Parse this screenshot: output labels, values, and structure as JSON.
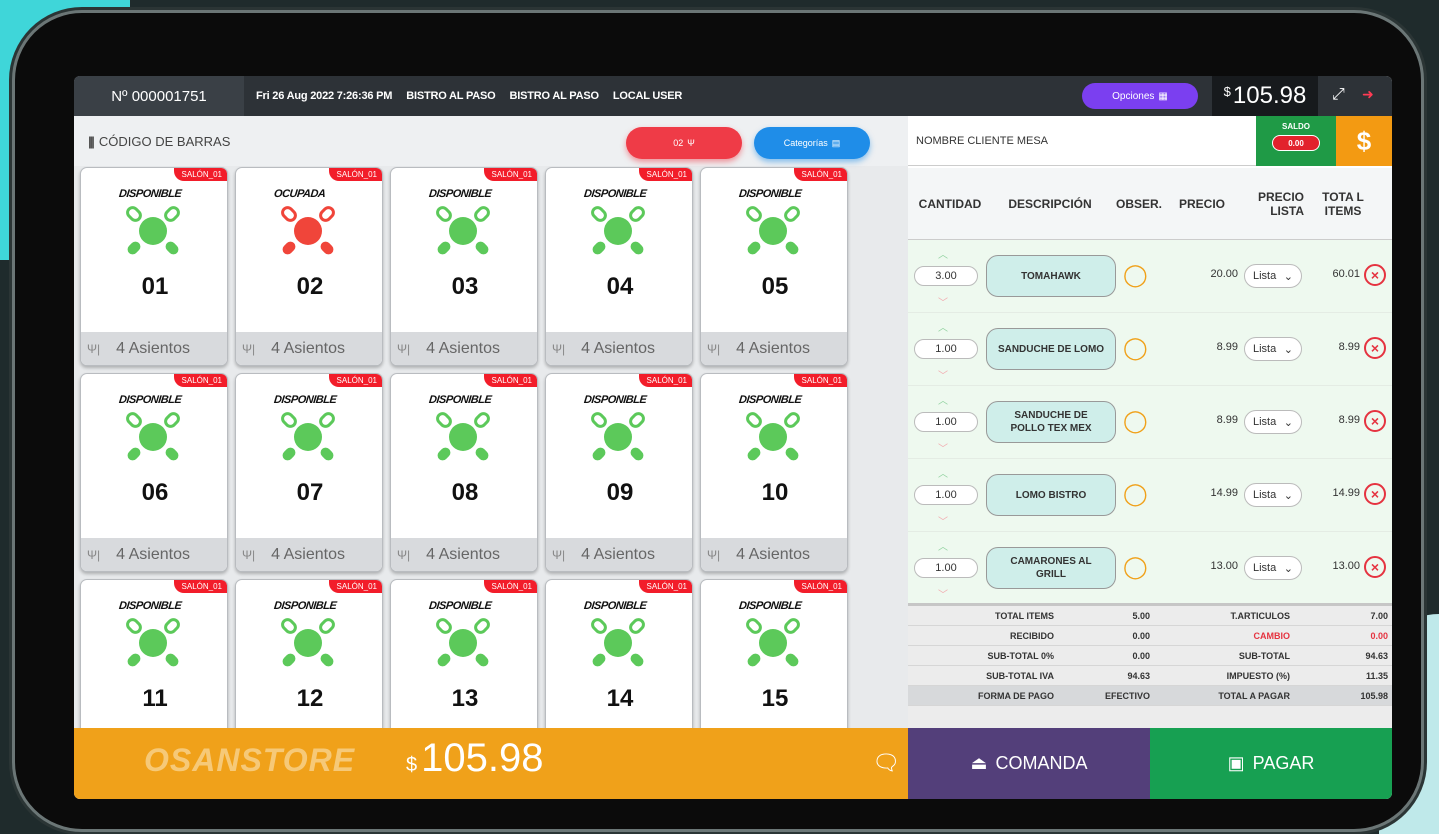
{
  "topbar": {
    "order_number": "Nº 000001751",
    "datetime": "Fri 26 Aug 2022 7:26:36 PM",
    "location1": "BISTRO AL PASO",
    "location2": "BISTRO AL PASO",
    "user": "LOCAL USER",
    "options_label": "Opciones",
    "currency_symbol": "$",
    "total": "105.98"
  },
  "left": {
    "barcode_label": "CÓDIGO DE BARRAS",
    "mesa_button": "02",
    "categories_button": "Categorías"
  },
  "tables": [
    {
      "salon": "SALÓN_01",
      "status": "DISPONIBLE",
      "number": "01",
      "seats": "4 Asientos",
      "state": "free"
    },
    {
      "salon": "SALÓN_01",
      "status": "OCUPADA",
      "number": "02",
      "seats": "4 Asientos",
      "state": "busy"
    },
    {
      "salon": "SALÓN_01",
      "status": "DISPONIBLE",
      "number": "03",
      "seats": "4 Asientos",
      "state": "free"
    },
    {
      "salon": "SALÓN_01",
      "status": "DISPONIBLE",
      "number": "04",
      "seats": "4 Asientos",
      "state": "free"
    },
    {
      "salon": "SALÓN_01",
      "status": "DISPONIBLE",
      "number": "05",
      "seats": "4 Asientos",
      "state": "free"
    },
    {
      "salon": "SALÓN_01",
      "status": "DISPONIBLE",
      "number": "06",
      "seats": "4 Asientos",
      "state": "free"
    },
    {
      "salon": "SALÓN_01",
      "status": "DISPONIBLE",
      "number": "07",
      "seats": "4 Asientos",
      "state": "free"
    },
    {
      "salon": "SALÓN_01",
      "status": "DISPONIBLE",
      "number": "08",
      "seats": "4 Asientos",
      "state": "free"
    },
    {
      "salon": "SALÓN_01",
      "status": "DISPONIBLE",
      "number": "09",
      "seats": "4 Asientos",
      "state": "free"
    },
    {
      "salon": "SALÓN_01",
      "status": "DISPONIBLE",
      "number": "10",
      "seats": "4 Asientos",
      "state": "free"
    },
    {
      "salon": "SALÓN_01",
      "status": "DISPONIBLE",
      "number": "11",
      "seats": "",
      "state": "free"
    },
    {
      "salon": "SALÓN_01",
      "status": "DISPONIBLE",
      "number": "12",
      "seats": "",
      "state": "free"
    },
    {
      "salon": "SALÓN_01",
      "status": "DISPONIBLE",
      "number": "13",
      "seats": "",
      "state": "free"
    },
    {
      "salon": "SALÓN_01",
      "status": "DISPONIBLE",
      "number": "14",
      "seats": "",
      "state": "free"
    },
    {
      "salon": "SALÓN_01",
      "status": "DISPONIBLE",
      "number": "15",
      "seats": "",
      "state": "free"
    }
  ],
  "bottom": {
    "brand": "OSANSTORE",
    "currency_symbol": "$",
    "total": "105.98",
    "comanda_label": "COMANDA",
    "pagar_label": "PAGAR"
  },
  "order": {
    "client_label": "NOMBRE CLIENTE MESA",
    "saldo_label": "SALDO",
    "saldo_value": "0.00",
    "dollar_label": "$",
    "headers": {
      "cantidad": "CANTIDAD",
      "descripcion": "DESCRIPCIÓN",
      "obser": "OBSER.",
      "precio": "PRECIO",
      "precio_lista": "PRECIO LISTA",
      "total_items": "TOTA L ITEMS"
    },
    "items": [
      {
        "qty": "3.00",
        "desc": "TOMAHAWK",
        "price": "20.00",
        "list": "Lista",
        "total": "60.01"
      },
      {
        "qty": "1.00",
        "desc": "SANDUCHE DE LOMO",
        "price": "8.99",
        "list": "Lista",
        "total": "8.99"
      },
      {
        "qty": "1.00",
        "desc": "SANDUCHE DE POLLO TEX MEX",
        "price": "8.99",
        "list": "Lista",
        "total": "8.99"
      },
      {
        "qty": "1.00",
        "desc": "LOMO BISTRO",
        "price": "14.99",
        "list": "Lista",
        "total": "14.99"
      },
      {
        "qty": "1.00",
        "desc": "CAMARONES AL GRILL",
        "price": "13.00",
        "list": "Lista",
        "total": "13.00"
      }
    ],
    "summary": [
      {
        "l1": "TOTAL ITEMS",
        "v1": "5.00",
        "l2": "T.ARTICULOS",
        "v2": "7.00"
      },
      {
        "l1": "RECIBIDO",
        "v1": "0.00",
        "l2": "CAMBIO",
        "v2": "0.00"
      },
      {
        "l1": "SUB-TOTAL 0%",
        "v1": "0.00",
        "l2": "SUB-TOTAL",
        "v2": "94.63"
      },
      {
        "l1": "SUB-TOTAL IVA",
        "v1": "94.63",
        "l2": "IMPUESTO (%)",
        "v2": "11.35"
      },
      {
        "l1": "FORMA DE PAGO",
        "v1": "EFECTIVO",
        "l2": "TOTAL A PAGAR",
        "v2": "105.98"
      }
    ]
  },
  "colors": {
    "free": "#5cc95a",
    "busy": "#f0453a",
    "accent_orange": "#f0a11a",
    "comanda": "#533f7a",
    "pagar": "#17a052",
    "cambio": "#e53340"
  }
}
